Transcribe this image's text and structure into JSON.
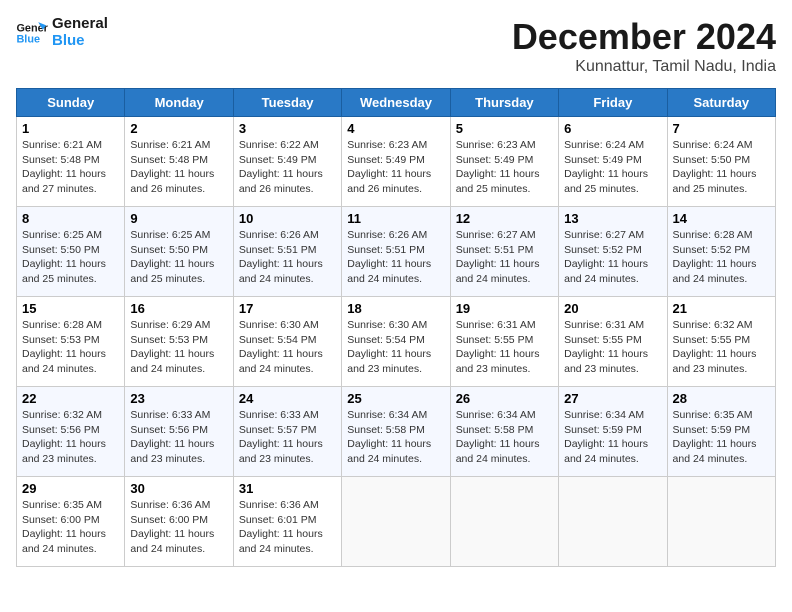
{
  "logo": {
    "line1": "General",
    "line2": "Blue"
  },
  "title": "December 2024",
  "location": "Kunnattur, Tamil Nadu, India",
  "weekdays": [
    "Sunday",
    "Monday",
    "Tuesday",
    "Wednesday",
    "Thursday",
    "Friday",
    "Saturday"
  ],
  "weeks": [
    [
      {
        "day": "1",
        "sunrise": "6:21 AM",
        "sunset": "5:48 PM",
        "daylight": "11 hours and 27 minutes."
      },
      {
        "day": "2",
        "sunrise": "6:21 AM",
        "sunset": "5:48 PM",
        "daylight": "11 hours and 26 minutes."
      },
      {
        "day": "3",
        "sunrise": "6:22 AM",
        "sunset": "5:49 PM",
        "daylight": "11 hours and 26 minutes."
      },
      {
        "day": "4",
        "sunrise": "6:23 AM",
        "sunset": "5:49 PM",
        "daylight": "11 hours and 26 minutes."
      },
      {
        "day": "5",
        "sunrise": "6:23 AM",
        "sunset": "5:49 PM",
        "daylight": "11 hours and 25 minutes."
      },
      {
        "day": "6",
        "sunrise": "6:24 AM",
        "sunset": "5:49 PM",
        "daylight": "11 hours and 25 minutes."
      },
      {
        "day": "7",
        "sunrise": "6:24 AM",
        "sunset": "5:50 PM",
        "daylight": "11 hours and 25 minutes."
      }
    ],
    [
      {
        "day": "8",
        "sunrise": "6:25 AM",
        "sunset": "5:50 PM",
        "daylight": "11 hours and 25 minutes."
      },
      {
        "day": "9",
        "sunrise": "6:25 AM",
        "sunset": "5:50 PM",
        "daylight": "11 hours and 25 minutes."
      },
      {
        "day": "10",
        "sunrise": "6:26 AM",
        "sunset": "5:51 PM",
        "daylight": "11 hours and 24 minutes."
      },
      {
        "day": "11",
        "sunrise": "6:26 AM",
        "sunset": "5:51 PM",
        "daylight": "11 hours and 24 minutes."
      },
      {
        "day": "12",
        "sunrise": "6:27 AM",
        "sunset": "5:51 PM",
        "daylight": "11 hours and 24 minutes."
      },
      {
        "day": "13",
        "sunrise": "6:27 AM",
        "sunset": "5:52 PM",
        "daylight": "11 hours and 24 minutes."
      },
      {
        "day": "14",
        "sunrise": "6:28 AM",
        "sunset": "5:52 PM",
        "daylight": "11 hours and 24 minutes."
      }
    ],
    [
      {
        "day": "15",
        "sunrise": "6:28 AM",
        "sunset": "5:53 PM",
        "daylight": "11 hours and 24 minutes."
      },
      {
        "day": "16",
        "sunrise": "6:29 AM",
        "sunset": "5:53 PM",
        "daylight": "11 hours and 24 minutes."
      },
      {
        "day": "17",
        "sunrise": "6:30 AM",
        "sunset": "5:54 PM",
        "daylight": "11 hours and 24 minutes."
      },
      {
        "day": "18",
        "sunrise": "6:30 AM",
        "sunset": "5:54 PM",
        "daylight": "11 hours and 23 minutes."
      },
      {
        "day": "19",
        "sunrise": "6:31 AM",
        "sunset": "5:55 PM",
        "daylight": "11 hours and 23 minutes."
      },
      {
        "day": "20",
        "sunrise": "6:31 AM",
        "sunset": "5:55 PM",
        "daylight": "11 hours and 23 minutes."
      },
      {
        "day": "21",
        "sunrise": "6:32 AM",
        "sunset": "5:55 PM",
        "daylight": "11 hours and 23 minutes."
      }
    ],
    [
      {
        "day": "22",
        "sunrise": "6:32 AM",
        "sunset": "5:56 PM",
        "daylight": "11 hours and 23 minutes."
      },
      {
        "day": "23",
        "sunrise": "6:33 AM",
        "sunset": "5:56 PM",
        "daylight": "11 hours and 23 minutes."
      },
      {
        "day": "24",
        "sunrise": "6:33 AM",
        "sunset": "5:57 PM",
        "daylight": "11 hours and 23 minutes."
      },
      {
        "day": "25",
        "sunrise": "6:34 AM",
        "sunset": "5:58 PM",
        "daylight": "11 hours and 24 minutes."
      },
      {
        "day": "26",
        "sunrise": "6:34 AM",
        "sunset": "5:58 PM",
        "daylight": "11 hours and 24 minutes."
      },
      {
        "day": "27",
        "sunrise": "6:34 AM",
        "sunset": "5:59 PM",
        "daylight": "11 hours and 24 minutes."
      },
      {
        "day": "28",
        "sunrise": "6:35 AM",
        "sunset": "5:59 PM",
        "daylight": "11 hours and 24 minutes."
      }
    ],
    [
      {
        "day": "29",
        "sunrise": "6:35 AM",
        "sunset": "6:00 PM",
        "daylight": "11 hours and 24 minutes."
      },
      {
        "day": "30",
        "sunrise": "6:36 AM",
        "sunset": "6:00 PM",
        "daylight": "11 hours and 24 minutes."
      },
      {
        "day": "31",
        "sunrise": "6:36 AM",
        "sunset": "6:01 PM",
        "daylight": "11 hours and 24 minutes."
      },
      null,
      null,
      null,
      null
    ]
  ],
  "labels": {
    "sunrise": "Sunrise:",
    "sunset": "Sunset:",
    "daylight": "Daylight:"
  }
}
